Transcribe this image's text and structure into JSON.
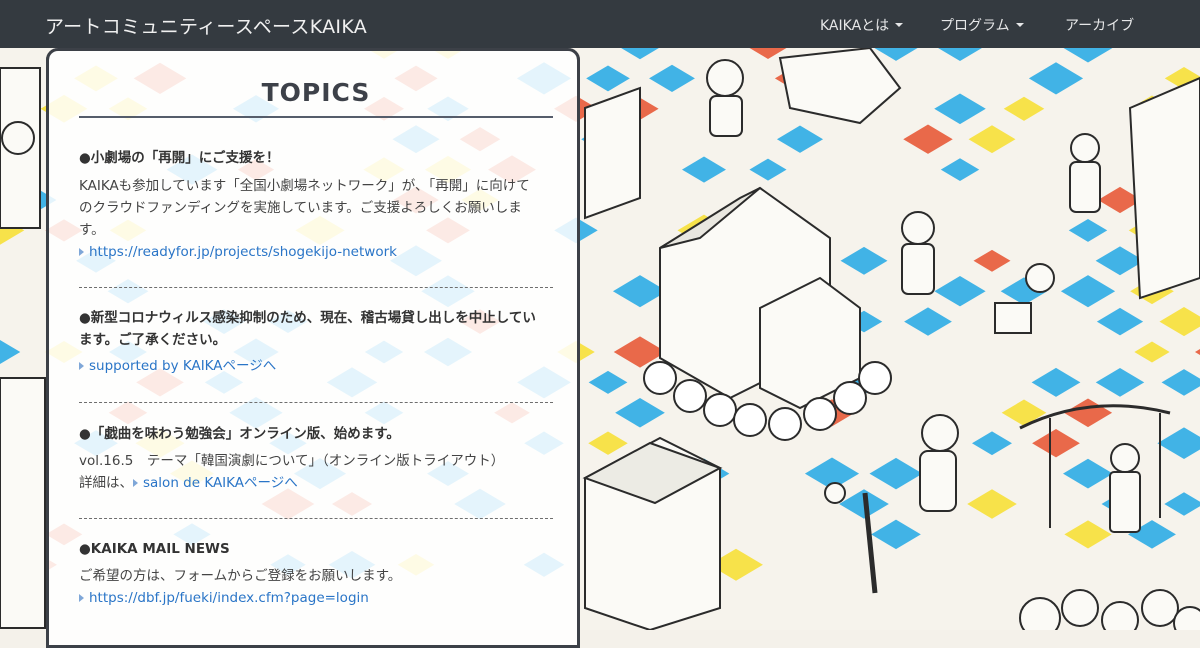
{
  "navbar": {
    "brand": "アートコミュニティースペースKAIKA",
    "items": [
      {
        "label": "KAIKAとは",
        "dropdown": true
      },
      {
        "label": "プログラム",
        "dropdown": true
      },
      {
        "label": "アーカイブ",
        "dropdown": false
      }
    ]
  },
  "topics": {
    "title": "TOPICS",
    "entries": [
      {
        "heading": "●小劇場の「再開」にご支援を！",
        "body_lines": [
          "KAIKAも参加しています「全国小劇場ネットワーク」が、「再開」に向けて",
          "のクラウドファンディングを実施しています。ご支援よろしくお願いしま",
          "す。"
        ],
        "link": "https://readyfor.jp/projects/shogekijo-network"
      },
      {
        "heading_lines": [
          "●新型コロナウィルス感染抑制のため、現在、稽古場貸し出しを中止してい",
          "ます。ご了承ください。"
        ],
        "link": "supported by KAIKAページへ"
      },
      {
        "heading": "●「戯曲を味わう勉強会」オンライン版、始めます。",
        "body_lines": [
          "vol.16.5　テーマ「韓国演劇について」（オンライン版トライアウト）"
        ],
        "link_prefix": "詳細は、",
        "link": "salon de KAIKAページへ"
      },
      {
        "heading": "●KAIKA MAIL NEWS",
        "body_lines": [
          "ご希望の方は、フォームからご登録をお願いします。"
        ],
        "link": "https://dbf.jp/fueki/index.cfm?page=login"
      }
    ]
  },
  "colors": {
    "navbar_bg": "#343a40",
    "link": "#2a75c7",
    "tile_blue": "#41b3e6",
    "tile_yellow": "#f7e24a",
    "tile_red": "#e9694a"
  }
}
